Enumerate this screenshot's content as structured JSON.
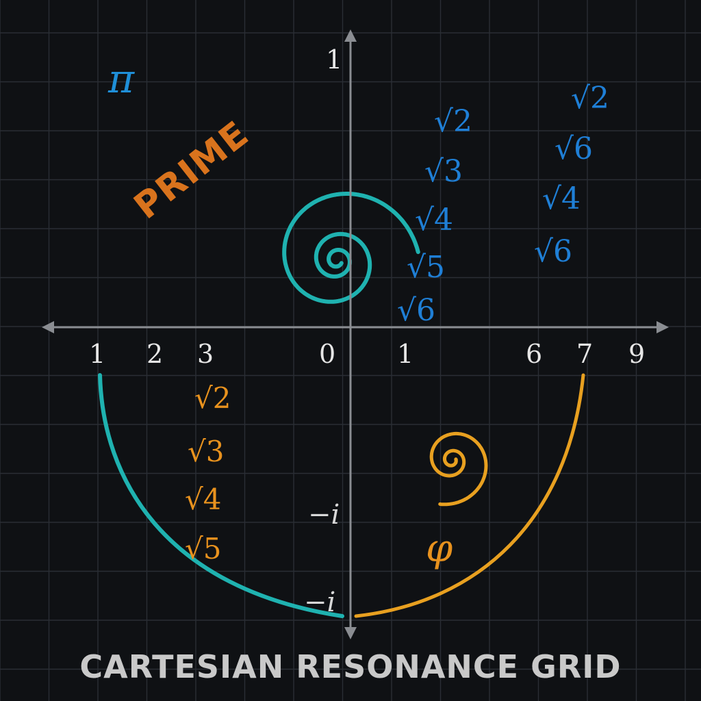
{
  "title": "CARTESIAN RESONANCE GRID",
  "symbols": {
    "pi": "π",
    "phi": "φ",
    "prime": "PRIME"
  },
  "axis": {
    "y_top": "1",
    "y_neg_i_upper": "−i",
    "y_neg_i_lower": "−i",
    "x_ticks_left": [
      "1",
      "2",
      "3"
    ],
    "x_origin": "0",
    "x_ticks_right": [
      "1",
      "6",
      "7",
      "9"
    ]
  },
  "roots": {
    "inner_blue": [
      "√2",
      "√3",
      "√4",
      "√5",
      "√6"
    ],
    "outer_blue": [
      "√2",
      "√6",
      "√4",
      "√6"
    ],
    "orange": [
      "√2",
      "√3",
      "√4",
      "√5"
    ]
  },
  "colors": {
    "background": "#0f1114",
    "teal_spiral": "#1fb2b0",
    "gold_spiral": "#e8a020",
    "blue_text": "#1f7fd6",
    "orange_text": "#e8921e"
  }
}
